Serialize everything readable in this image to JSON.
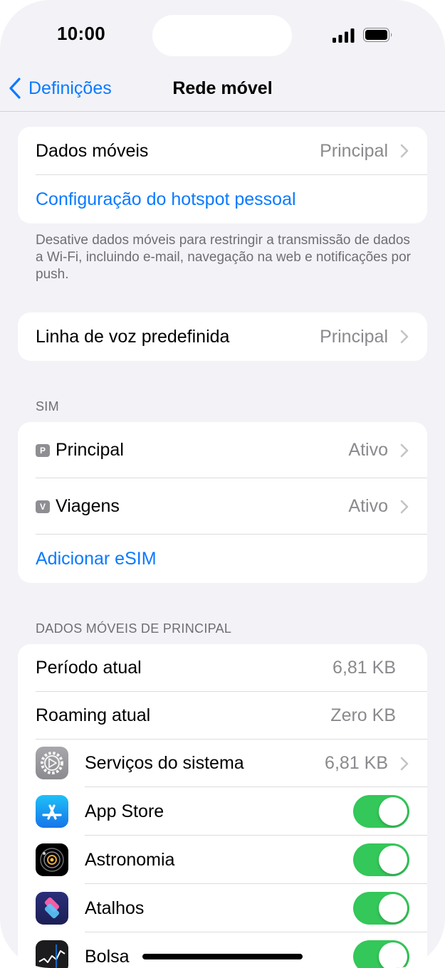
{
  "status_bar": {
    "time": "10:00",
    "signal_icon": "cellular-signal-icon",
    "battery_icon": "battery-full-icon"
  },
  "nav": {
    "back_label": "Definições",
    "title": "Rede móvel"
  },
  "group1": {
    "mobile_data_label": "Dados móveis",
    "mobile_data_value": "Principal",
    "hotspot_label": "Configuração do hotspot pessoal"
  },
  "footnote1": "Desative dados móveis para restringir a transmissão de dados a Wi-Fi, incluindo e-mail, navegação na web e notificações por push.",
  "voice": {
    "label": "Linha de voz predefinida",
    "value": "Principal"
  },
  "sim_section": {
    "header": "SIM",
    "items": [
      {
        "badge": "P",
        "label": "Principal",
        "value": "Ativo"
      },
      {
        "badge": "V",
        "label": "Viagens",
        "value": "Ativo"
      }
    ],
    "add_esim_label": "Adicionar eSIM"
  },
  "usage_section": {
    "header": "DADOS MÓVEIS DE PRINCIPAL",
    "current_period_label": "Período atual",
    "current_period_value": "6,81 KB",
    "current_roaming_label": "Roaming atual",
    "current_roaming_value": "Zero KB",
    "apps": [
      {
        "icon": "system-services-gear-icon",
        "label": "Serviços do sistema",
        "value": "6,81 KB",
        "type": "chevron"
      },
      {
        "icon": "app-store-icon",
        "label": "App Store",
        "enabled": true,
        "type": "toggle"
      },
      {
        "icon": "astronomy-icon",
        "label": "Astronomia",
        "enabled": true,
        "type": "toggle"
      },
      {
        "icon": "shortcuts-icon",
        "label": "Atalhos",
        "enabled": true,
        "type": "toggle"
      },
      {
        "icon": "stocks-icon",
        "label": "Bolsa",
        "enabled": true,
        "type": "toggle"
      }
    ]
  },
  "colors": {
    "accent": "#0a7aff",
    "toggle_on": "#34c759",
    "background": "#f2f2f7",
    "secondary_text": "#8a8a8e"
  }
}
